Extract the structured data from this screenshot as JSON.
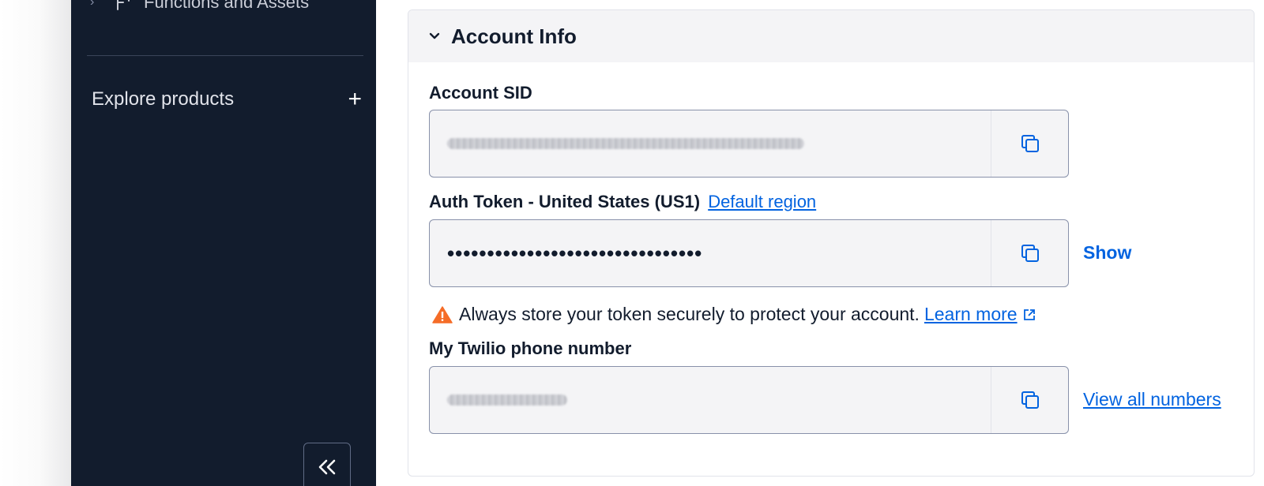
{
  "sidebar": {
    "top_item_label": "Functions and Assets",
    "explore_label": "Explore products",
    "explore_icon": "plus-icon",
    "collapse_icon": "double-chevron-left-icon",
    "background": "#121c2d"
  },
  "card": {
    "title": "Account Info",
    "account_sid": {
      "label": "Account SID",
      "value_note": "blurred"
    },
    "auth_token": {
      "label": "Auth Token - United States (US1)",
      "region_link": "Default region",
      "value": "••••••••••••••••••••••••••••••••",
      "show_label": "Show"
    },
    "warning": {
      "text": "Always store your token securely to protect your account.",
      "link": "Learn more",
      "icon": "warning-triangle-icon"
    },
    "phone": {
      "label": "My Twilio phone number",
      "view_all_label": "View all numbers"
    }
  },
  "colors": {
    "link": "#0263e0",
    "warning": "#f56c27",
    "field_bg": "#f4f4f6",
    "text": "#121c2d"
  }
}
